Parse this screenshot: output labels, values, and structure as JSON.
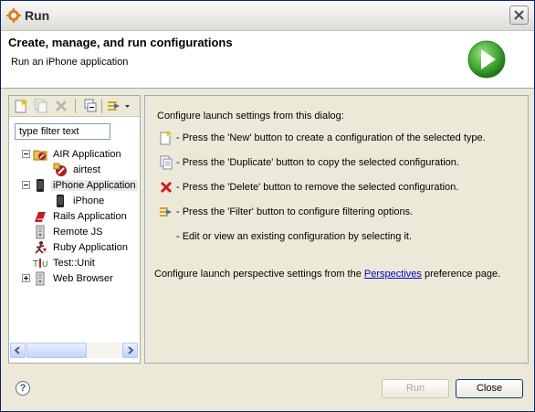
{
  "window": {
    "title": "Run"
  },
  "header": {
    "title": "Create, manage, and run configurations",
    "subtitle": "Run an iPhone application"
  },
  "toolbar": {
    "new_icon": "new-config-icon",
    "duplicate_icon": "duplicate-icon",
    "delete_icon": "delete-icon",
    "collapse_icon": "collapse-all-icon",
    "filter_icon": "filter-icon"
  },
  "filter": {
    "value": "type filter text"
  },
  "tree": {
    "items": [
      {
        "label": "AIR Application"
      },
      {
        "label": "airtest"
      },
      {
        "label": "iPhone Application"
      },
      {
        "label": "iPhone"
      },
      {
        "label": "Rails Application"
      },
      {
        "label": "Remote JS"
      },
      {
        "label": "Ruby Application"
      },
      {
        "label": "Test::Unit"
      },
      {
        "label": "Web Browser"
      }
    ]
  },
  "help": {
    "intro": "Configure launch settings from this dialog:",
    "new_line": "- Press the 'New' button to create a configuration of the selected type.",
    "duplicate_line": "- Press the 'Duplicate' button to copy the selected configuration.",
    "delete_line": "- Press the 'Delete' button to remove the selected configuration.",
    "filter_line": "- Press the 'Filter' button to configure filtering options.",
    "edit_line": "- Edit or view an existing configuration by selecting it.",
    "perspective_prefix": "Configure launch perspective settings from the ",
    "perspective_link": "Perspectives",
    "perspective_suffix": " preference page."
  },
  "buttons": {
    "help": "?",
    "run": "Run",
    "close": "Close"
  },
  "colors": {
    "accent": "#3a9f2d",
    "selection": "#e8e8e8",
    "link": "#0000cc"
  }
}
